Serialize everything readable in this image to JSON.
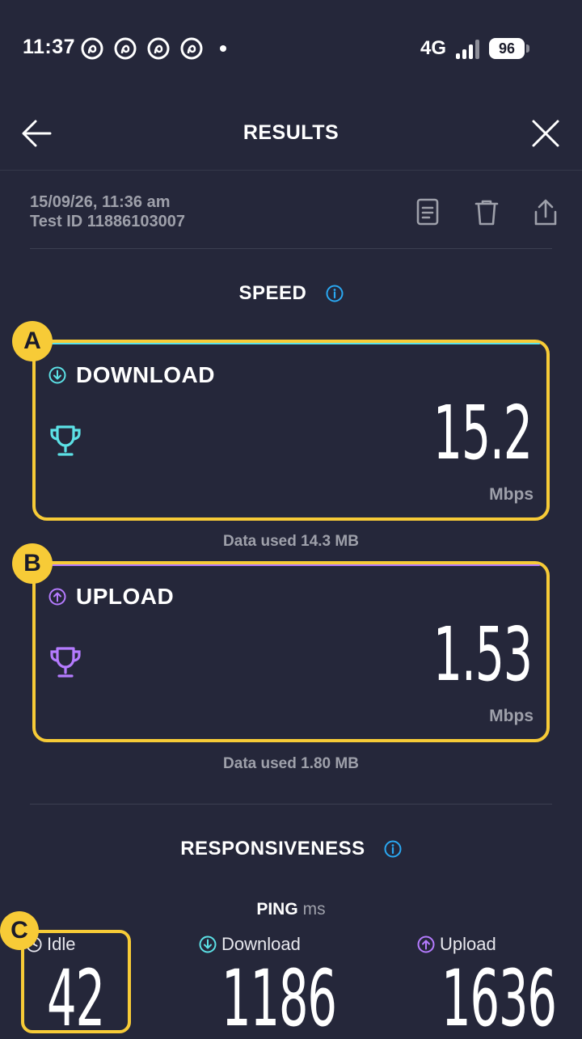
{
  "status_bar": {
    "time": "11:37",
    "notification_icons": [
      "threads-icon",
      "threads-icon",
      "threads-icon",
      "threads-icon"
    ],
    "network": "4G",
    "battery": "96"
  },
  "header": {
    "title": "RESULTS"
  },
  "meta": {
    "datetime": "15/09/26, 11:36 am",
    "test_id": "Test ID 11886103007"
  },
  "speed": {
    "title": "SPEED",
    "download": {
      "label": "DOWNLOAD",
      "value": "15.2",
      "unit": "Mbps",
      "data_used": "Data used 14.3 MB",
      "accent": "#5ce1e6"
    },
    "upload": {
      "label": "UPLOAD",
      "value": "1.53",
      "unit": "Mbps",
      "data_used": "Data used 1.80 MB",
      "accent": "#b57bff"
    }
  },
  "responsiveness": {
    "title": "RESPONSIVENESS",
    "ping_label": "PING",
    "ping_unit": "ms",
    "idle": {
      "label": "Idle",
      "value": "42"
    },
    "download": {
      "label": "Download",
      "value": "1186"
    },
    "upload": {
      "label": "Upload",
      "value": "1636"
    }
  },
  "annotations": {
    "a": "A",
    "b": "B",
    "c": "C",
    "color": "#f7cb37"
  },
  "colors": {
    "background": "#25273a",
    "info": "#2aa8f2",
    "muted": "#9ea0aa"
  }
}
